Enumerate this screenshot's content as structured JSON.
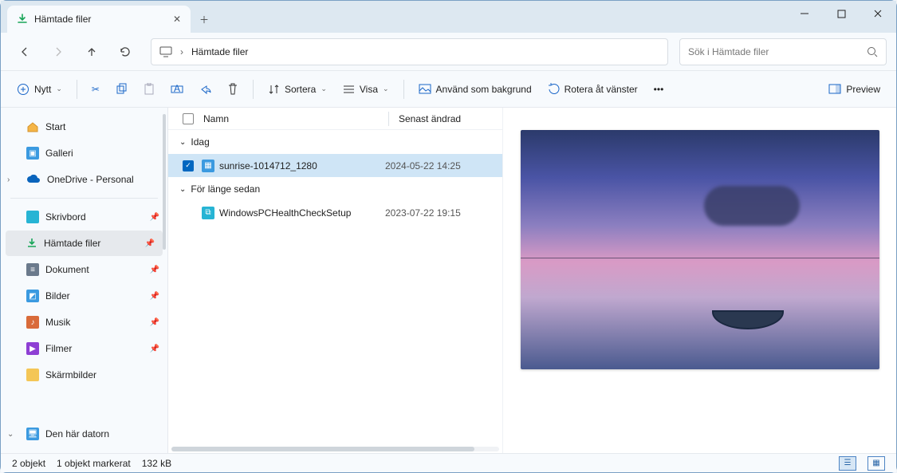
{
  "window": {
    "tab_title": "Hämtade filer"
  },
  "address": {
    "location": "Hämtade filer"
  },
  "search": {
    "placeholder": "Sök i Hämtade filer"
  },
  "toolbar": {
    "new": "Nytt",
    "sort": "Sortera",
    "view": "Visa",
    "set_bg": "Använd som bakgrund",
    "rotate_left": "Rotera åt vänster",
    "preview": "Preview"
  },
  "sidebar": {
    "start": "Start",
    "gallery": "Galleri",
    "onedrive": "OneDrive - Personal",
    "desktop": "Skrivbord",
    "downloads": "Hämtade filer",
    "documents": "Dokument",
    "pictures": "Bilder",
    "music": "Musik",
    "videos": "Filmer",
    "screenshots": "Skärmbilder",
    "this_pc": "Den här datorn"
  },
  "columns": {
    "name": "Namn",
    "modified": "Senast ändrad"
  },
  "groups": {
    "today": "Idag",
    "long_ago": "För länge sedan"
  },
  "files": {
    "f1": {
      "name": "sunrise-1014712_1280",
      "date": "2024-05-22 14:25"
    },
    "f2": {
      "name": "WindowsPCHealthCheckSetup",
      "date": "2023-07-22 19:15"
    }
  },
  "status": {
    "count": "2 objekt",
    "selected": "1 objekt markerat",
    "size": "132 kB"
  }
}
